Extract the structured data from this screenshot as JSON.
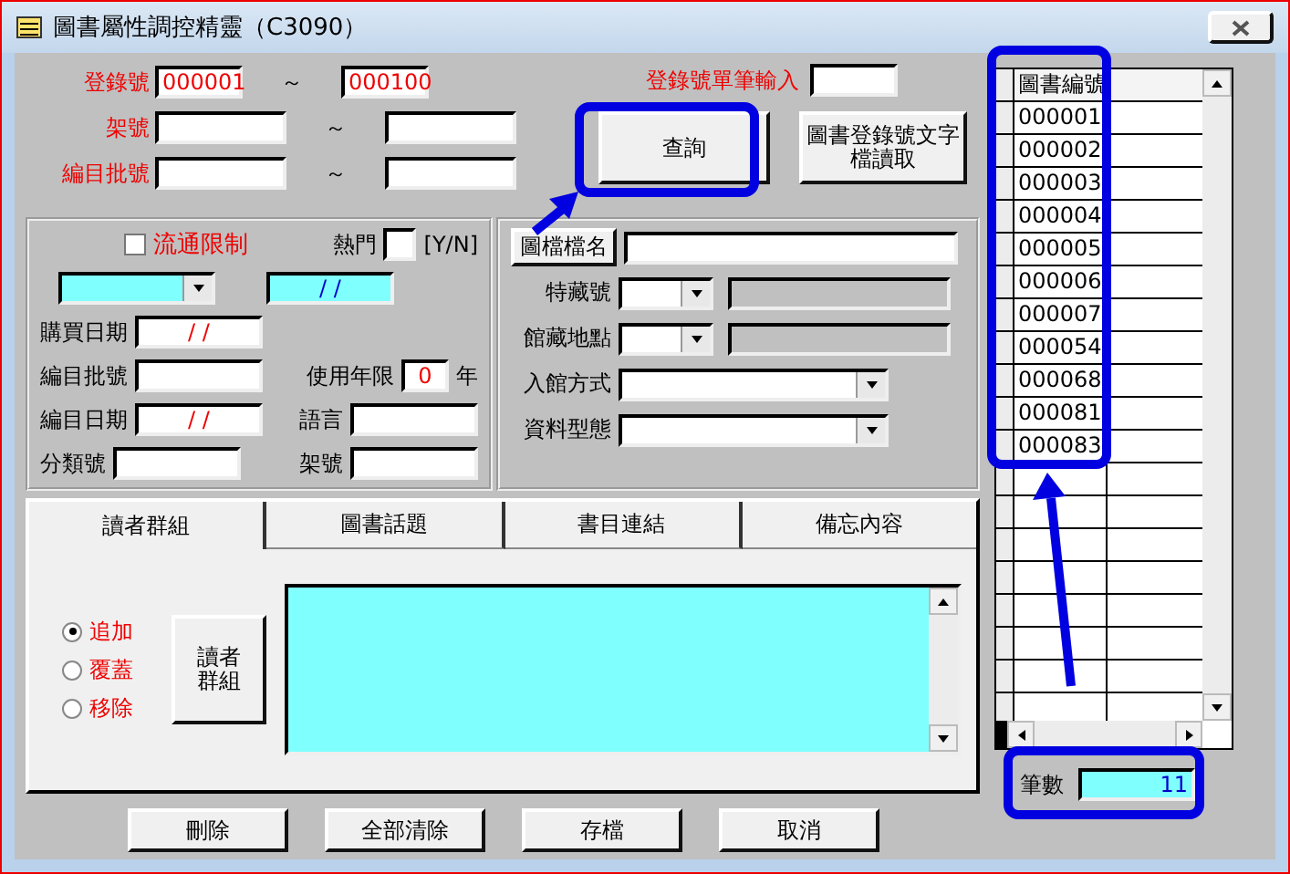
{
  "window": {
    "title": "圖書屬性調控精靈（C3090）"
  },
  "ranges": [
    {
      "label": "登錄號",
      "from": "000001",
      "separator": "～",
      "to": "000100",
      "kind": "short"
    },
    {
      "label": "架號",
      "separator": "～",
      "kind": "wide"
    },
    {
      "label": "編目批號",
      "separator": "～",
      "kind": "wide"
    }
  ],
  "single_entry": {
    "label": "登錄號單筆輸入"
  },
  "actions": [
    {
      "label": "查詢"
    },
    {
      "label": "圖書登錄號文字檔讀取"
    }
  ],
  "circulation": {
    "label": "流通限制",
    "checked": false
  },
  "hot": {
    "label": "熱門",
    "hint": "[Y/N]"
  },
  "date_field": {
    "value": "/   /"
  },
  "left_rows": [
    {
      "cells": [
        {
          "label": "購買日期",
          "value": "/   /",
          "kind": "date"
        }
      ]
    },
    {
      "cells": [
        {
          "label": "編目批號",
          "kind": "text"
        },
        {
          "label": "使用年限",
          "value": "0",
          "unit": "年",
          "kind": "years"
        }
      ]
    },
    {
      "cells": [
        {
          "label": "編目日期",
          "value": "/   /",
          "kind": "date"
        },
        {
          "label": "語言",
          "kind": "text"
        }
      ]
    },
    {
      "cells": [
        {
          "label": "分類號",
          "kind": "text"
        },
        {
          "label": "架號",
          "kind": "text"
        }
      ]
    }
  ],
  "image_file": {
    "button": "圖檔檔名"
  },
  "right_fields": [
    {
      "label": "特藏號",
      "kind": "pair"
    },
    {
      "label": "館藏地點",
      "kind": "pair"
    },
    {
      "label": "入館方式",
      "kind": "combo"
    },
    {
      "label": "資料型態",
      "kind": "combo"
    }
  ],
  "tabs": [
    {
      "label": "讀者群組",
      "selected": true
    },
    {
      "label": "圖書話題",
      "selected": false
    },
    {
      "label": "書目連結",
      "selected": false
    },
    {
      "label": "備忘內容",
      "selected": false
    }
  ],
  "modes": [
    {
      "label": "追加",
      "selected": true
    },
    {
      "label": "覆蓋",
      "selected": false
    },
    {
      "label": "移除",
      "selected": false
    }
  ],
  "group_button": {
    "label": "讀者群組"
  },
  "buttons": [
    {
      "label": "刪除"
    },
    {
      "label": "全部清除"
    },
    {
      "label": "存檔"
    },
    {
      "label": "取消"
    }
  ],
  "grid": {
    "header": "圖書編號",
    "rows": [
      "000001",
      "000002",
      "000003",
      "000004",
      "000005",
      "000006",
      "000007",
      "000054",
      "000068",
      "000081",
      "000083"
    ]
  },
  "count": {
    "label": "筆數",
    "value": "11"
  }
}
